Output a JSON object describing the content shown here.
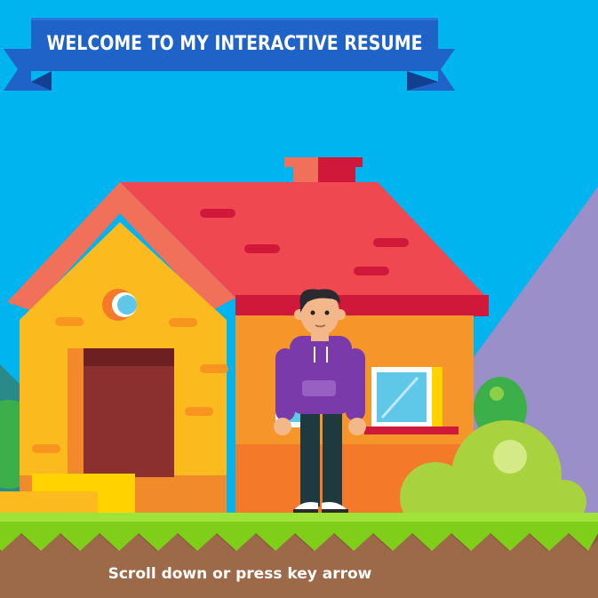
{
  "banner": {
    "title": "WELCOME TO MY INTERACTIVE RESUME"
  },
  "hint": {
    "text": "Scroll down or press key arrow"
  },
  "colors": {
    "sky": "#00b4f0",
    "banner": "#1f63c8",
    "banner_dark": "#123f90",
    "roof": "#f04850",
    "wall": "#fbbb1f",
    "wall_side": "#f6952a",
    "door": "#8b2f2f",
    "hoodie": "#7b3aaa",
    "grass": "#7fcf1a",
    "dirt": "#8a5a3c",
    "bush": "#a8d23e",
    "mountain": "#9a8fc8"
  },
  "icons": [
    "ribbon-banner-icon",
    "house-icon",
    "character-icon",
    "bush-icon",
    "mountain-icon",
    "window-icon",
    "door-icon",
    "round-window-icon"
  ]
}
